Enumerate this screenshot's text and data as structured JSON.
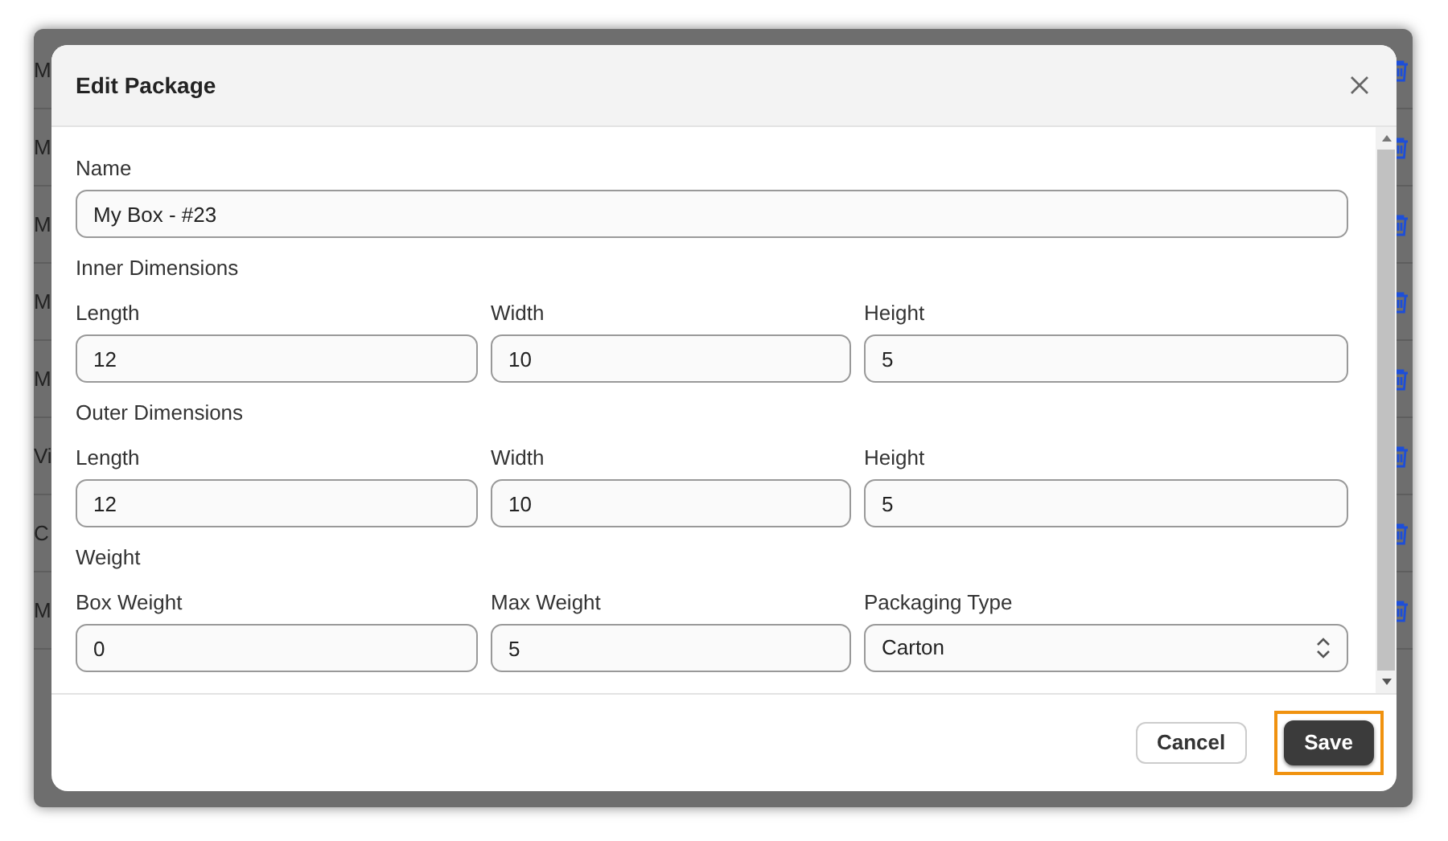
{
  "background_rows": [
    {
      "text": "M"
    },
    {
      "text": "M"
    },
    {
      "text": "M"
    },
    {
      "text": "M"
    },
    {
      "text": "M"
    },
    {
      "text": "Vi"
    },
    {
      "text": "C"
    },
    {
      "text": "M"
    }
  ],
  "dialog": {
    "title": "Edit Package",
    "name": {
      "label": "Name",
      "value": "My Box - #23"
    },
    "sections": [
      {
        "heading": "Inner Dimensions",
        "fields": [
          {
            "kind": "text",
            "label": "Length",
            "value": "12"
          },
          {
            "kind": "text",
            "label": "Width",
            "value": "10"
          },
          {
            "kind": "text",
            "label": "Height",
            "value": "5"
          }
        ]
      },
      {
        "heading": "Outer Dimensions",
        "fields": [
          {
            "kind": "text",
            "label": "Length",
            "value": "12"
          },
          {
            "kind": "text",
            "label": "Width",
            "value": "10"
          },
          {
            "kind": "text",
            "label": "Height",
            "value": "5"
          }
        ]
      },
      {
        "heading": "Weight",
        "fields": [
          {
            "kind": "text",
            "label": "Box Weight",
            "value": "0"
          },
          {
            "kind": "text",
            "label": "Max Weight",
            "value": "5"
          },
          {
            "kind": "select",
            "label": "Packaging Type",
            "value": "Carton"
          }
        ]
      }
    ],
    "buttons": [
      {
        "kind": "secondary",
        "label": "Cancel",
        "highlighted": false
      },
      {
        "kind": "primary",
        "label": "Save",
        "highlighted": true
      }
    ]
  }
}
